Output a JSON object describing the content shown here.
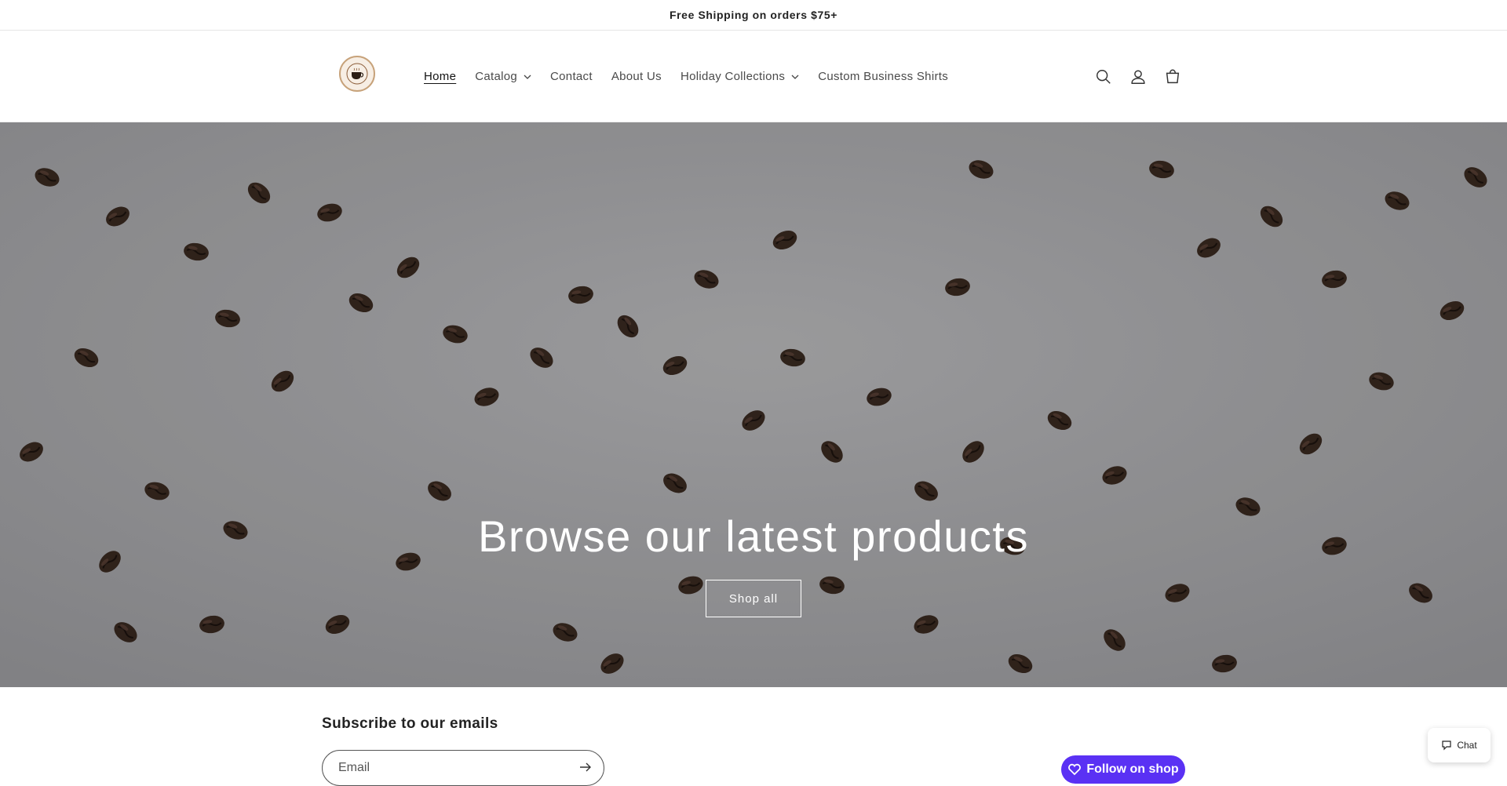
{
  "announcement": {
    "text": "Free Shipping on orders $75+"
  },
  "header": {
    "logo_icon": "coffee-cup-logo",
    "nav": [
      {
        "label": "Home",
        "active": true,
        "dropdown": false
      },
      {
        "label": "Catalog",
        "active": false,
        "dropdown": true
      },
      {
        "label": "Contact",
        "active": false,
        "dropdown": false
      },
      {
        "label": "About Us",
        "active": false,
        "dropdown": false
      },
      {
        "label": "Holiday Collections",
        "active": false,
        "dropdown": true
      },
      {
        "label": "Custom Business Shirts",
        "active": false,
        "dropdown": false
      }
    ],
    "icons": [
      "search-icon",
      "account-icon",
      "cart-icon"
    ]
  },
  "hero": {
    "title": "Browse our latest products",
    "button_label": "Shop all",
    "background_color": "#9a9a9c"
  },
  "newsletter": {
    "title": "Subscribe to our emails",
    "email_placeholder": "Email"
  },
  "follow": {
    "label": "Follow on shop",
    "color": "#5a31f4"
  },
  "chat": {
    "label": "Chat"
  }
}
